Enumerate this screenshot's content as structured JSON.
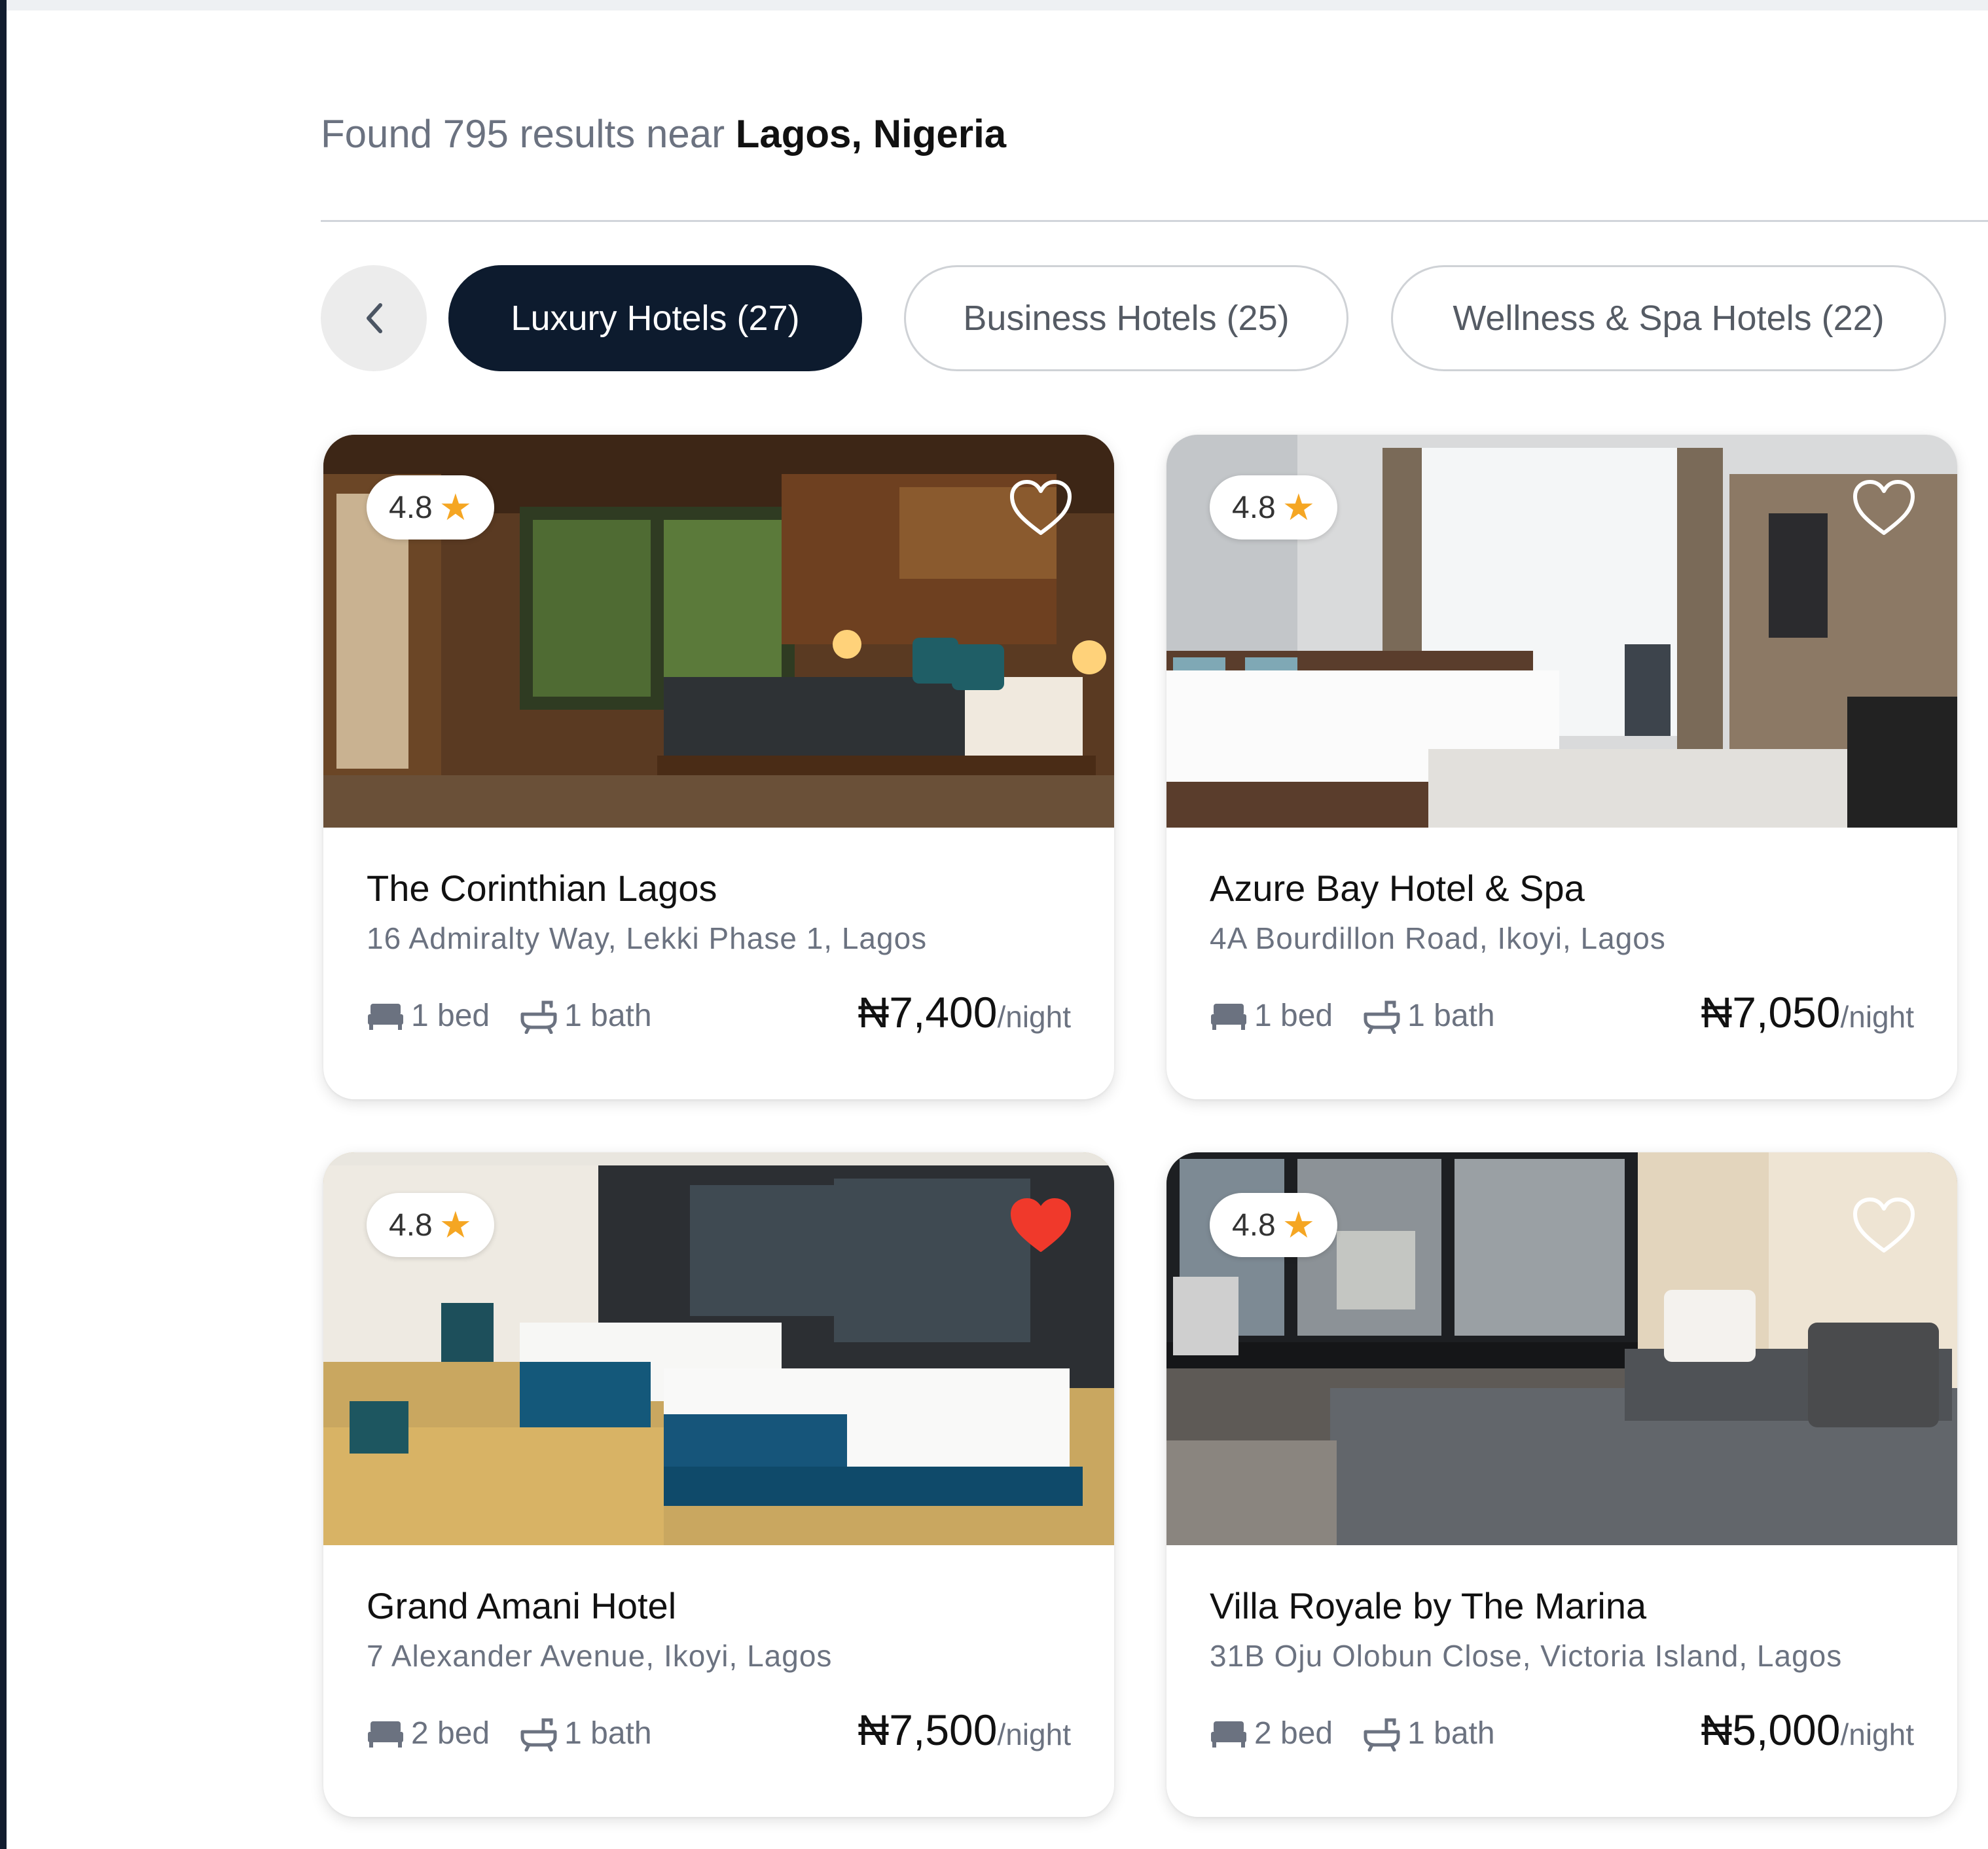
{
  "header": {
    "results_prefix": "Found 795 results near",
    "location": "Lagos, Nigeria"
  },
  "categories": {
    "back_icon": "chevron-left-icon",
    "items": [
      {
        "label": "Luxury Hotels (27)",
        "active": true
      },
      {
        "label": "Business Hotels (25)",
        "active": false
      },
      {
        "label": "Wellness & Spa Hotels (22)",
        "active": false
      }
    ]
  },
  "listings": [
    {
      "name": "The Corinthian Lagos",
      "address": "16 Admiralty Way, Lekki Phase 1, Lagos",
      "rating": "4.8",
      "beds": "1 bed",
      "baths": "1 bath",
      "price": "₦7,400",
      "per": "/night",
      "favorited": false
    },
    {
      "name": "Azure Bay Hotel & Spa",
      "address": "4A Bourdillon Road, Ikoyi, Lagos",
      "rating": "4.8",
      "beds": "1 bed",
      "baths": "1 bath",
      "price": "₦7,050",
      "per": "/night",
      "favorited": false
    },
    {
      "name": "Grand Amani Hotel",
      "address": "7 Alexander Avenue, Ikoyi, Lagos",
      "rating": "4.8",
      "beds": "2 bed",
      "baths": "1 bath",
      "price": "₦7,500",
      "per": "/night",
      "favorited": true
    },
    {
      "name": "Villa Royale by The Marina",
      "address": "31B Oju Olobun Close, Victoria Island, Lagos",
      "rating": "4.8",
      "beds": "2 bed",
      "baths": "1 bath",
      "price": "₦5,000",
      "per": "/night",
      "favorited": false
    }
  ],
  "colors": {
    "active_chip": "#0d1b2e",
    "star": "#f5a623",
    "favorite_filled": "#f0392b",
    "muted_text": "#6b7280"
  }
}
